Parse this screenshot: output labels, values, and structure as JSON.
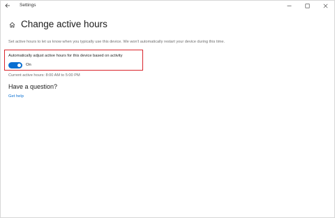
{
  "window": {
    "app_title": "Settings"
  },
  "titlebar": {
    "back_icon": "back-arrow-icon",
    "minimize_icon": "minimize-icon",
    "maximize_icon": "maximize-icon",
    "close_icon": "close-icon"
  },
  "header": {
    "home_icon": "home-icon",
    "title": "Change active hours"
  },
  "main": {
    "description": "Set active hours to let us know when you typically use this device. We won't automatically restart your device during this time.",
    "setting": {
      "label": "Automatically adjust active hours for this device based on activity",
      "toggle_state": "On",
      "enabled": true
    },
    "current_hours": "Current active hours: 8:00 AM to 5:00 PM",
    "question_heading": "Have a question?",
    "help_link": "Get help"
  },
  "colors": {
    "accent": "#0a6fd1",
    "highlight": "#d9242b"
  }
}
